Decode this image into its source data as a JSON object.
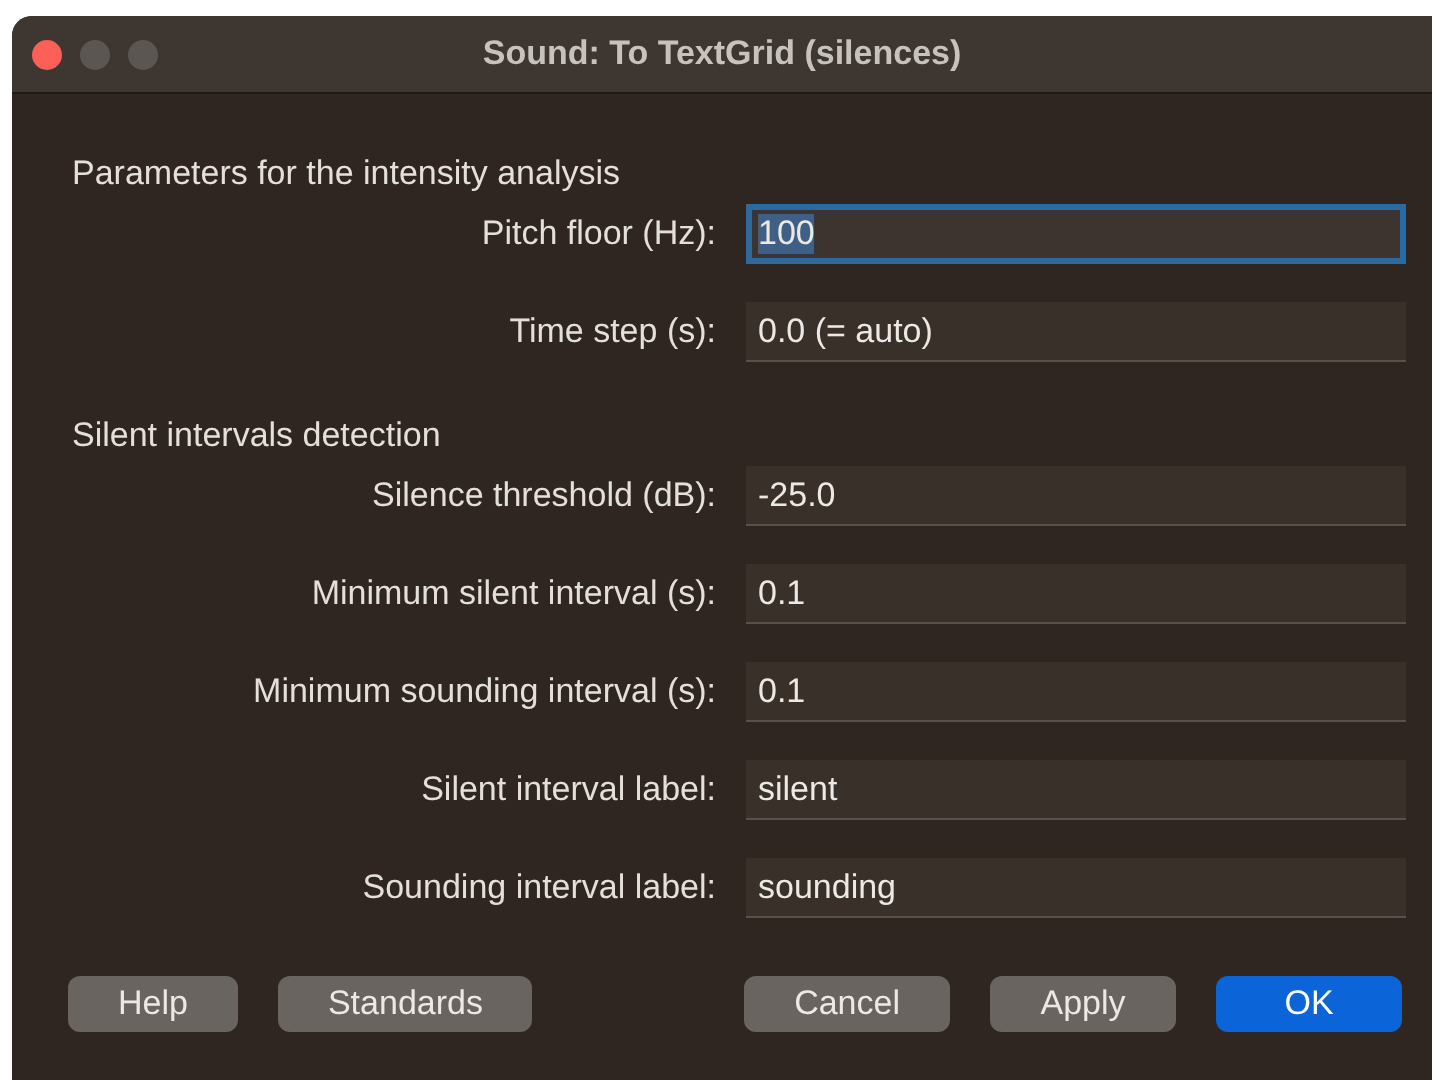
{
  "window": {
    "title": "Sound: To TextGrid (silences)"
  },
  "rows": [
    {
      "kind": "heading",
      "text": "Parameters for the intensity analysis"
    },
    {
      "kind": "field",
      "label": "Pitch floor (Hz):",
      "value": "100",
      "focused": true
    },
    {
      "kind": "field",
      "label": "Time step (s):",
      "value": "0.0 (= auto)",
      "focused": false
    },
    {
      "kind": "heading",
      "text": "Silent intervals detection"
    },
    {
      "kind": "field",
      "label": "Silence threshold (dB):",
      "value": "-25.0",
      "focused": false
    },
    {
      "kind": "field",
      "label": "Minimum silent interval (s):",
      "value": "0.1",
      "focused": false
    },
    {
      "kind": "field",
      "label": "Minimum sounding interval (s):",
      "value": "0.1",
      "focused": false
    },
    {
      "kind": "field",
      "label": "Silent interval label:",
      "value": "silent",
      "focused": false
    },
    {
      "kind": "field",
      "label": "Sounding interval label:",
      "value": "sounding",
      "focused": false
    }
  ],
  "buttons_left": [
    {
      "label": "Help",
      "default": false
    },
    {
      "label": "Standards",
      "default": false
    }
  ],
  "buttons_right": [
    {
      "label": "Cancel",
      "default": false
    },
    {
      "label": "Apply",
      "default": false
    },
    {
      "label": "OK",
      "default": true
    }
  ]
}
